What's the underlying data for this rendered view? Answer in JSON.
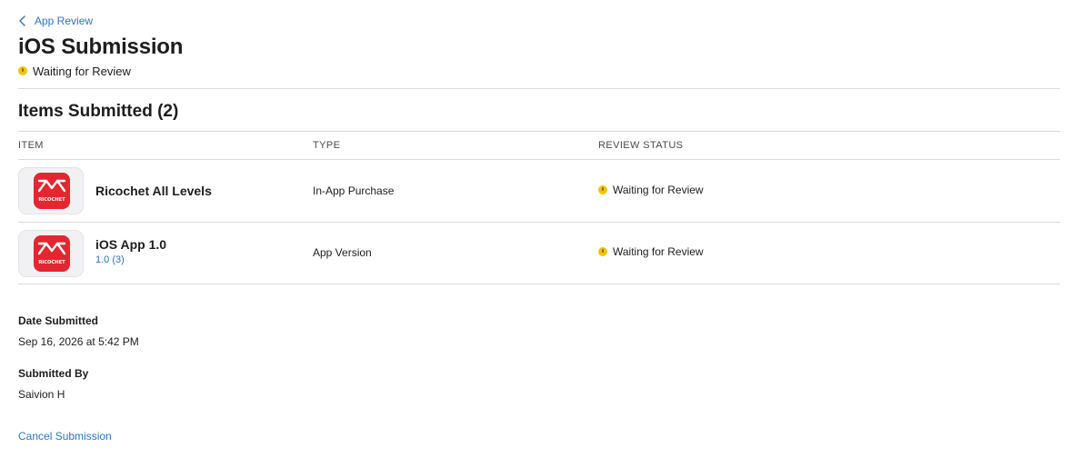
{
  "breadcrumb": {
    "label": "App Review"
  },
  "page": {
    "title": "iOS Submission",
    "status": "Waiting for Review",
    "status_color": "#f4c20d",
    "accent_color": "#2b74c7"
  },
  "items": {
    "title": "Items Submitted (2)",
    "columns": [
      "ITEM",
      "TYPE",
      "REVIEW STATUS"
    ],
    "rows": [
      {
        "icon": "ricochet-app-icon",
        "icon_text": "RICOCHET",
        "name": "Ricochet All Levels",
        "sub": "",
        "type": "In-App Purchase",
        "status": "Waiting for Review"
      },
      {
        "icon": "ricochet-app-icon",
        "icon_text": "RICOCHET",
        "name": "iOS App 1.0",
        "sub": "1.0 (3)",
        "type": "App Version",
        "status": "Waiting for Review"
      }
    ]
  },
  "details": {
    "date_label": "Date Submitted",
    "date_value": "Sep 16, 2026 at 5:42 PM",
    "by_label": "Submitted By",
    "by_value": "Saivion H"
  },
  "actions": {
    "cancel_label": "Cancel Submission"
  }
}
